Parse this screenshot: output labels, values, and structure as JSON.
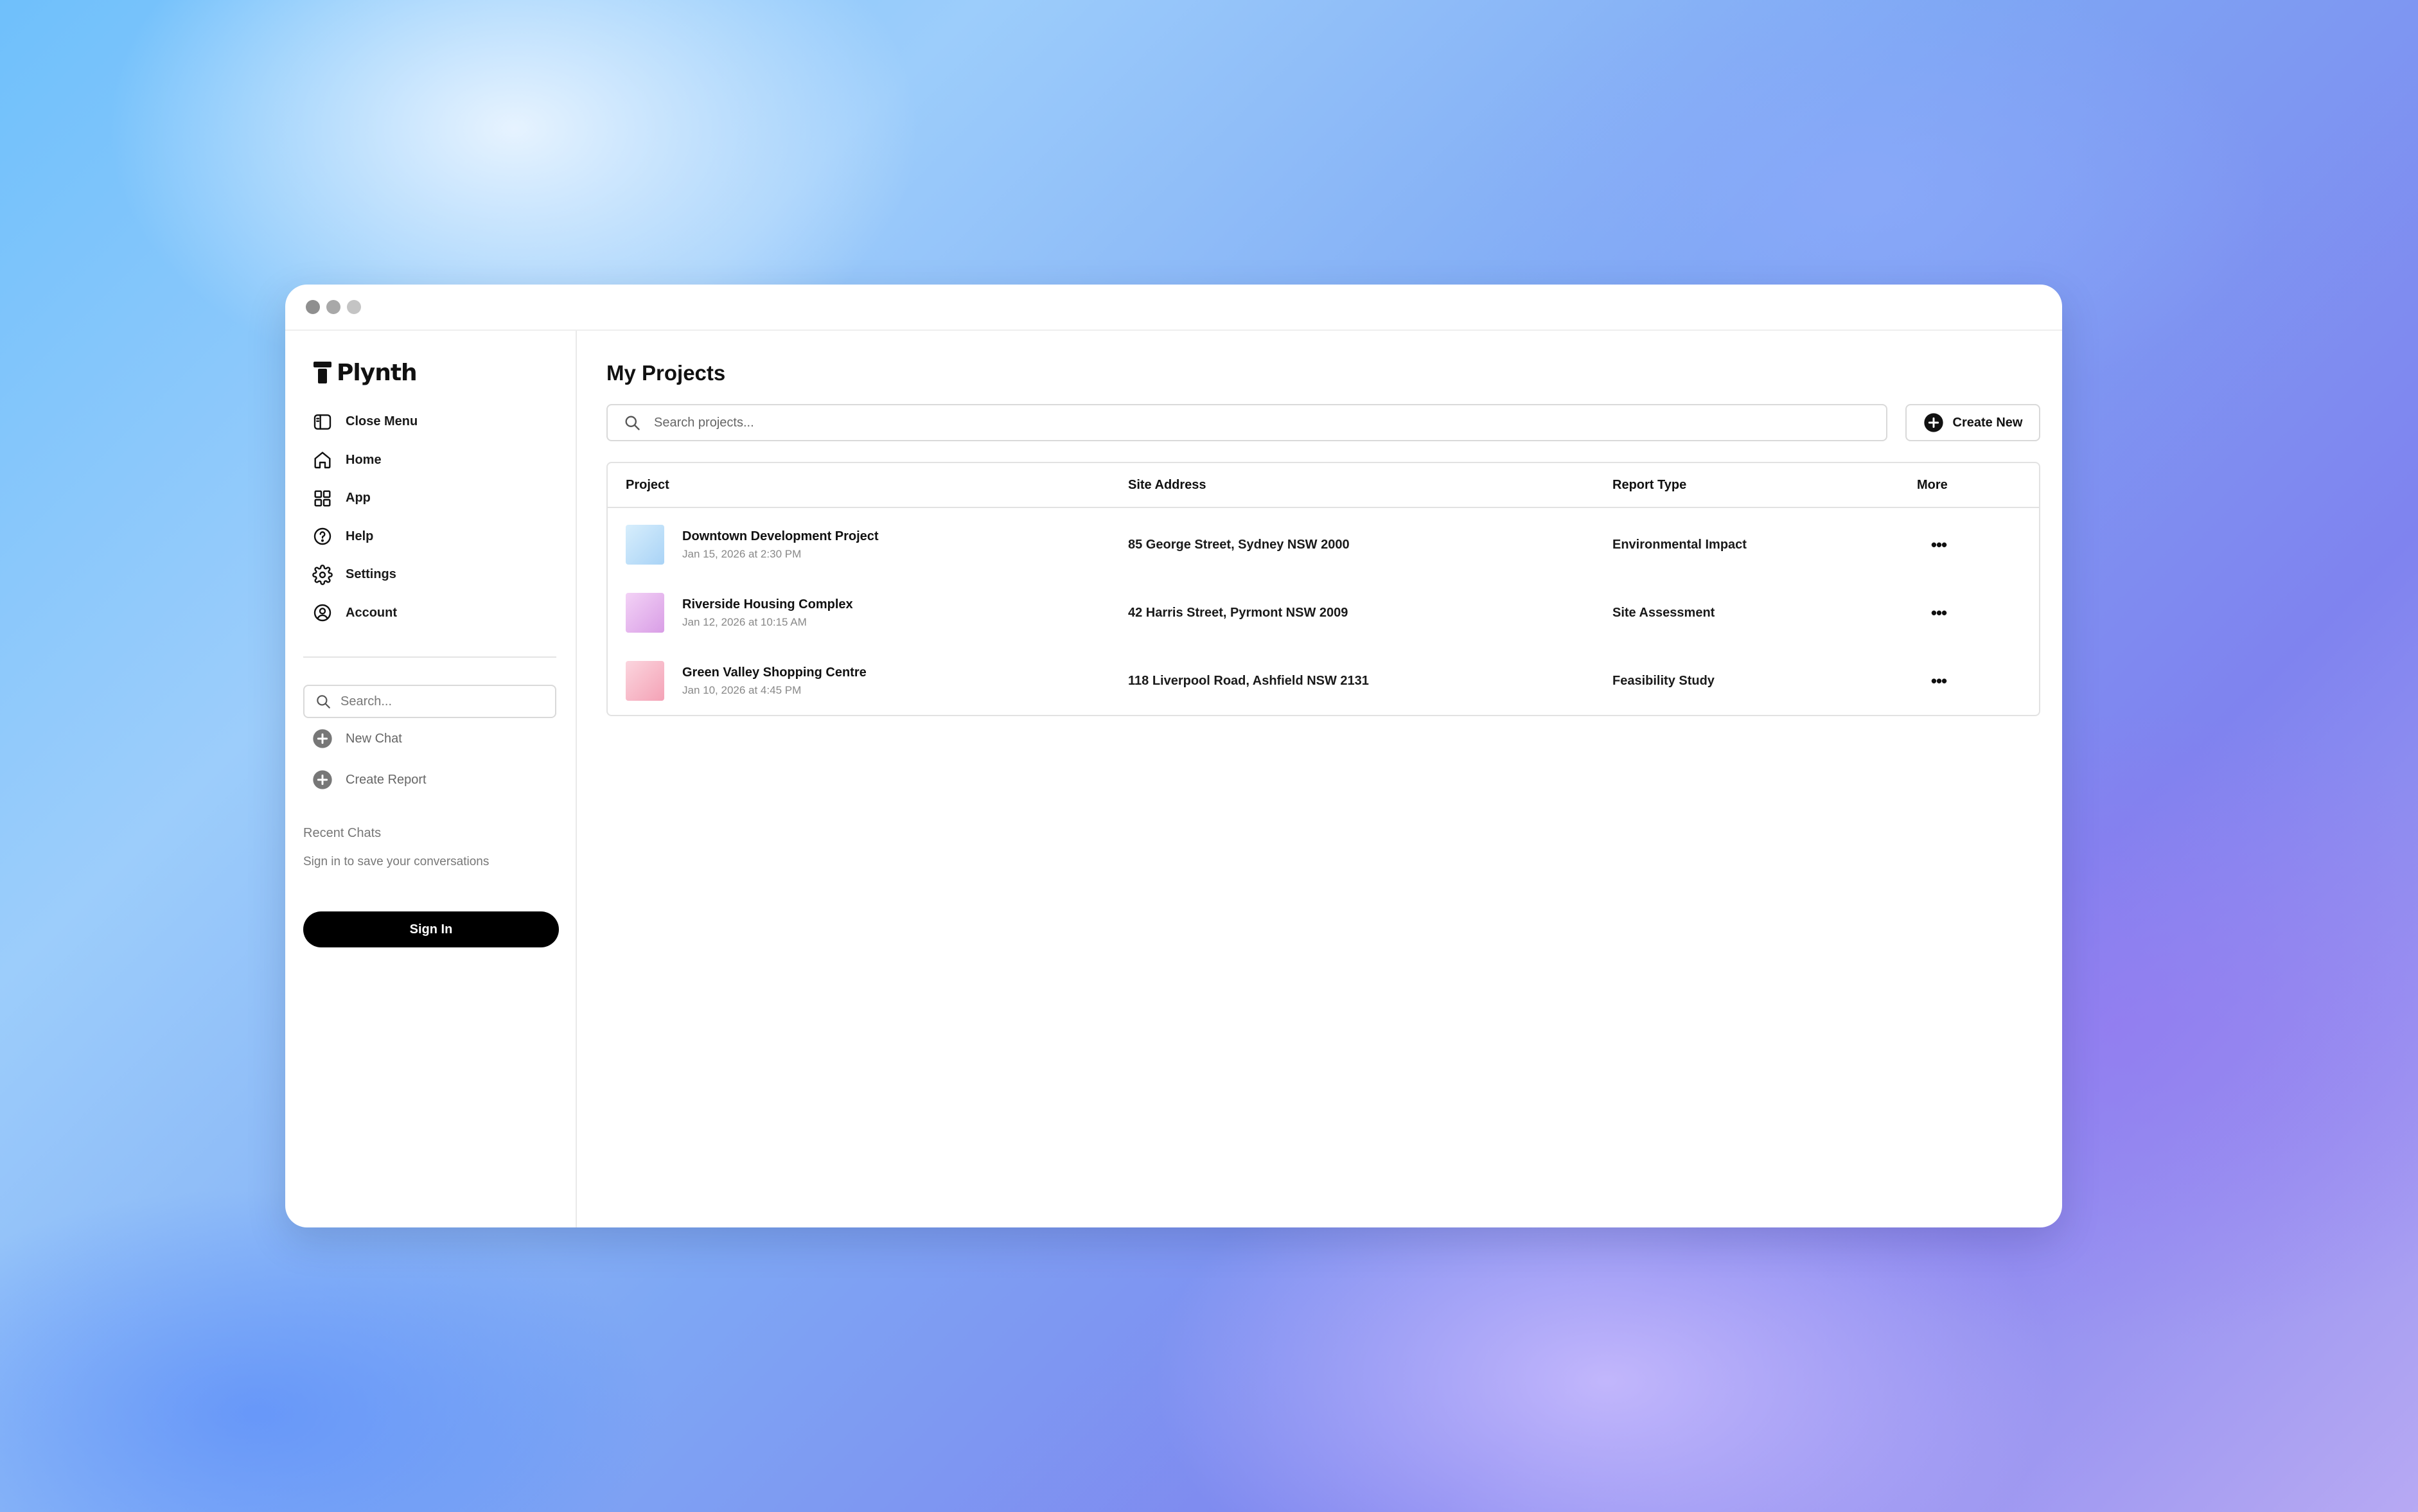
{
  "window": {
    "controls": [
      "close",
      "minimize",
      "maximize"
    ]
  },
  "sidebar": {
    "logo_text": "Plynth",
    "nav": [
      {
        "label": "Close Menu",
        "icon": "sidebar-panel-icon"
      },
      {
        "label": "Home",
        "icon": "home-icon"
      },
      {
        "label": "App",
        "icon": "apps-grid-icon"
      },
      {
        "label": "Help",
        "icon": "help-circle-icon"
      },
      {
        "label": "Settings",
        "icon": "gear-icon"
      },
      {
        "label": "Account",
        "icon": "user-circle-icon"
      }
    ],
    "search_placeholder": "Search...",
    "actions": [
      {
        "label": "New Chat",
        "icon": "plus-circle-icon"
      },
      {
        "label": "Create Report",
        "icon": "plus-circle-icon"
      }
    ],
    "recent_title": "Recent Chats",
    "recent_note": "Sign in to save your conversations",
    "signin_label": "Sign In"
  },
  "main": {
    "title": "My Projects",
    "search_placeholder": "Search projects...",
    "create_label": "Create New",
    "columns": {
      "project": "Project",
      "address": "Site Address",
      "type": "Report Type",
      "more": "More"
    },
    "rows": [
      {
        "name": "Downtown Development Project",
        "date": "Jan 15, 2026 at 2:30 PM",
        "address": "85 George Street, Sydney NSW 2000",
        "type": "Environmental Impact",
        "more": "•••",
        "thumb_colors": [
          "#d7eefc",
          "#a9d3f6"
        ]
      },
      {
        "name": "Riverside Housing Complex",
        "date": "Jan 12, 2026 at 10:15 AM",
        "address": "42 Harris Street, Pyrmont NSW 2009",
        "type": "Site Assessment",
        "more": "•••",
        "thumb_colors": [
          "#f3d2f6",
          "#d99ee6"
        ]
      },
      {
        "name": "Green Valley Shopping Centre",
        "date": "Jan 10, 2026 at 4:45 PM",
        "address": "118 Liverpool Road, Ashfield NSW 2131",
        "type": "Feasibility Study",
        "more": "•••",
        "thumb_colors": [
          "#fbd5de",
          "#f4a2b6"
        ]
      }
    ]
  },
  "colors": {
    "accent": "#000000",
    "border": "#e2e2e2",
    "muted_text": "#777777"
  }
}
